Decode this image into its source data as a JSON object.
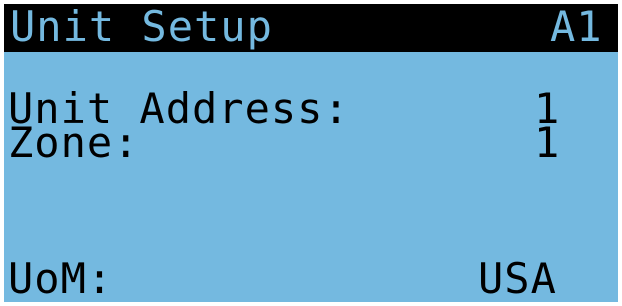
{
  "header": {
    "title": "Unit Setup",
    "screen_id": "A1"
  },
  "fields": {
    "unit_address_label": "Unit Address:",
    "unit_address_value": "1",
    "zone_label": "Zone:",
    "zone_value": "1",
    "uom_label": "UoM:",
    "uom_value": "USA"
  },
  "colors": {
    "lcd_background": "#74b9e0",
    "header_background": "#000000",
    "text": "#000000"
  }
}
